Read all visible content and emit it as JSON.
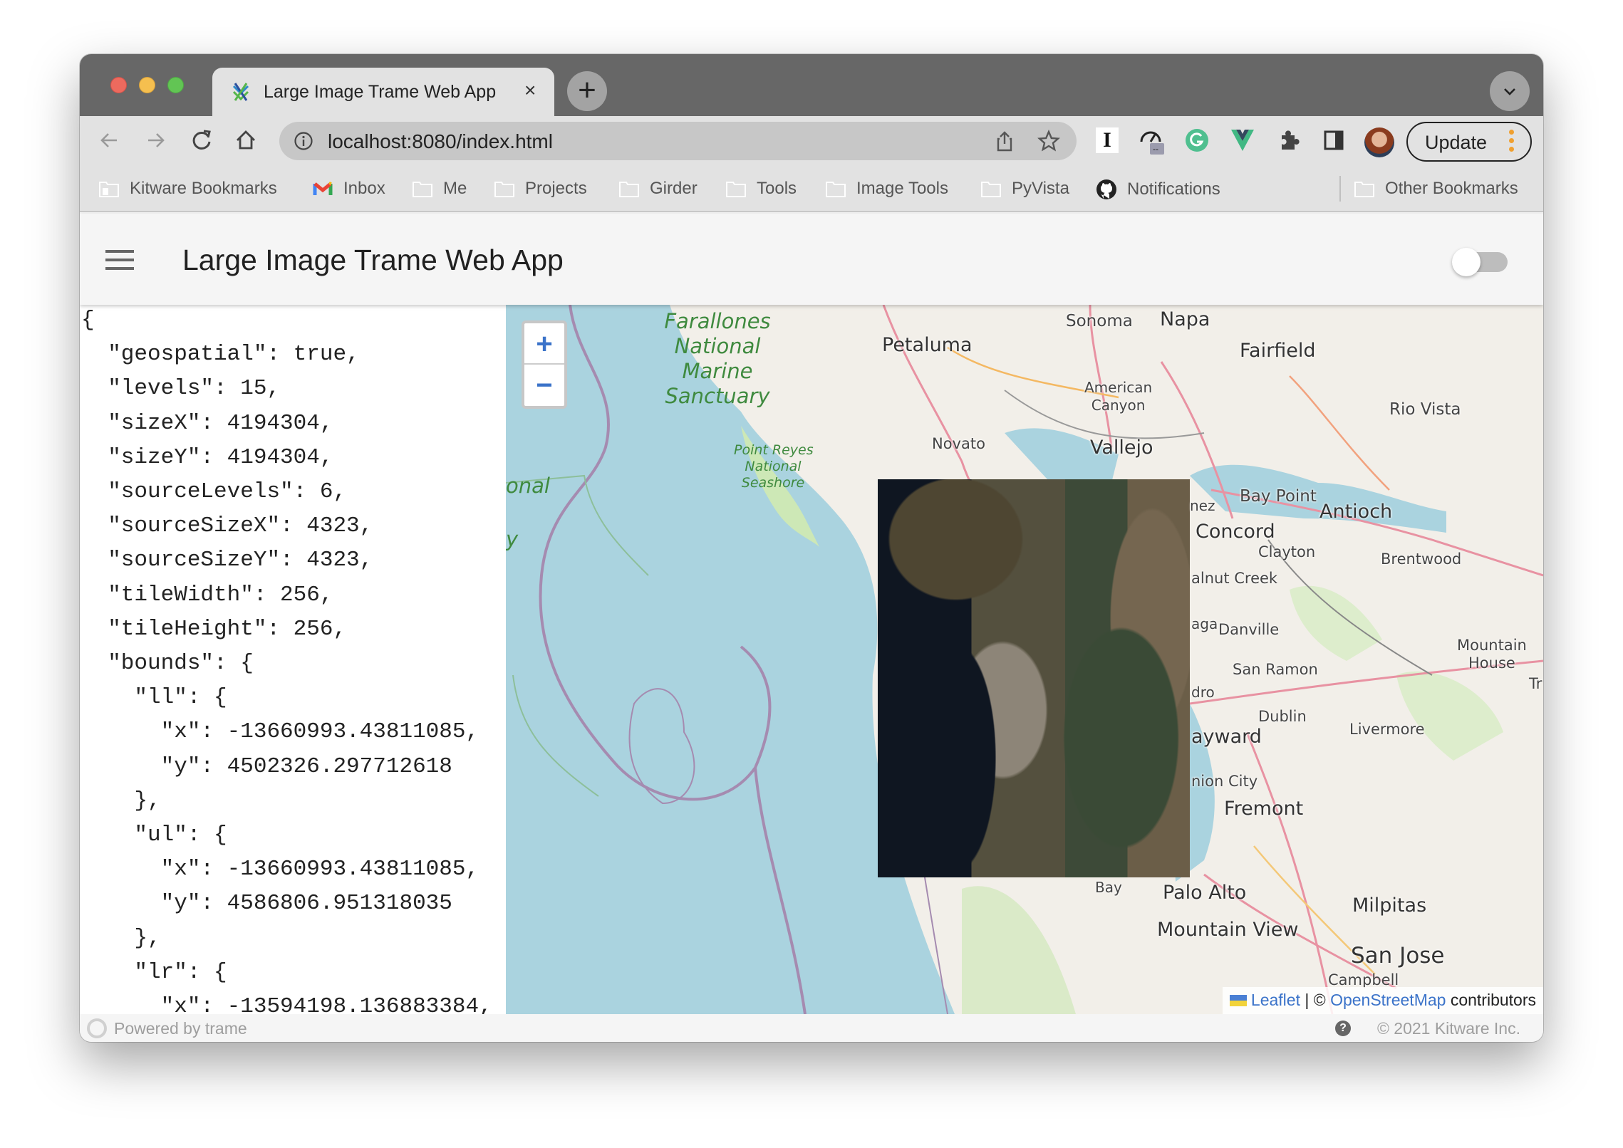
{
  "browser": {
    "tab_title": "Large Image Trame Web App",
    "tab_close": "×",
    "new_tab": "+",
    "url": "localhost:8080/index.html",
    "update_label": "Update",
    "bookmarks": [
      {
        "label": "Kitware Bookmarks",
        "icon": "building-folder-icon"
      },
      {
        "label": "Inbox",
        "icon": "gmail-icon"
      },
      {
        "label": "Me",
        "icon": "folder-icon"
      },
      {
        "label": "Projects",
        "icon": "folder-icon"
      },
      {
        "label": "Girder",
        "icon": "folder-icon"
      },
      {
        "label": "Tools",
        "icon": "folder-icon"
      },
      {
        "label": "Image Tools",
        "icon": "folder-icon"
      },
      {
        "label": "PyVista",
        "icon": "folder-icon"
      },
      {
        "label": "Notifications",
        "icon": "github-icon"
      }
    ],
    "other_bookmarks": "Other Bookmarks",
    "extension_badge": "--"
  },
  "app": {
    "title": "Large Image Trame Web App",
    "toggle_on": false
  },
  "metadata_json_lines": [
    "{",
    "  \"geospatial\": true,",
    "  \"levels\": 15,",
    "  \"sizeX\": 4194304,",
    "  \"sizeY\": 4194304,",
    "  \"sourceLevels\": 6,",
    "  \"sourceSizeX\": 4323,",
    "  \"sourceSizeY\": 4323,",
    "  \"tileWidth\": 256,",
    "  \"tileHeight\": 256,",
    "  \"bounds\": {",
    "    \"ll\": {",
    "      \"x\": -13660993.43811085,",
    "      \"y\": 4502326.297712618",
    "    },",
    "    \"ul\": {",
    "      \"x\": -13660993.43811085,",
    "      \"y\": 4586806.951318035",
    "    },",
    "    \"lr\": {",
    "      \"x\": -13594198.136883384,"
  ],
  "map": {
    "zoom_in": "+",
    "zoom_out": "−",
    "labels": {
      "farallones": [
        "Farallones",
        "National",
        "Marine",
        "Sanctuary"
      ],
      "point_reyes": [
        "Point Reyes",
        "National",
        "Seashore"
      ],
      "onal": "onal",
      "y": "y",
      "sonoma": "Sonoma",
      "napa": "Napa",
      "petaluma": "Petaluma",
      "fairfield": "Fairfield",
      "american_canyon": [
        "American",
        "Canyon"
      ],
      "rio_vista": "Rio Vista",
      "novato": "Novato",
      "vallejo": "Vallejo",
      "bay_point": "Bay Point",
      "antioch": "Antioch",
      "nez": "nez",
      "concord": "Concord",
      "clayton": "Clayton",
      "brentwood": "Brentwood",
      "walnut_creek": "alnut Creek",
      "aga": "aga",
      "danville": "Danville",
      "san_ramon": "San Ramon",
      "mountain_house": [
        "Mountain",
        "House"
      ],
      "tr": "Tr",
      "dro": "dro",
      "dublin": "Dublin",
      "livermore": "Livermore",
      "hayward": "ayward",
      "union_city": "nion City",
      "fremont": "Fremont",
      "bay": "Bay",
      "palo_alto": "Palo Alto",
      "milpitas": "Milpitas",
      "mountain_view": "Mountain View",
      "san_jose": "San Jose",
      "campbell": "Campbell"
    },
    "attribution": {
      "leaflet": "Leaflet",
      "separator": "| ©",
      "osm": "OpenStreetMap",
      "contributors": "contributors"
    }
  },
  "footer": {
    "powered_by": "Powered by trame",
    "help": "?",
    "copyright": "© 2021 Kitware Inc."
  },
  "colors": {
    "accent_blue": "#3b73c9",
    "tab_strip": "#676767",
    "toolbar": "#e2e2e2",
    "water": "#aad3df",
    "land": "#f2efe9"
  }
}
